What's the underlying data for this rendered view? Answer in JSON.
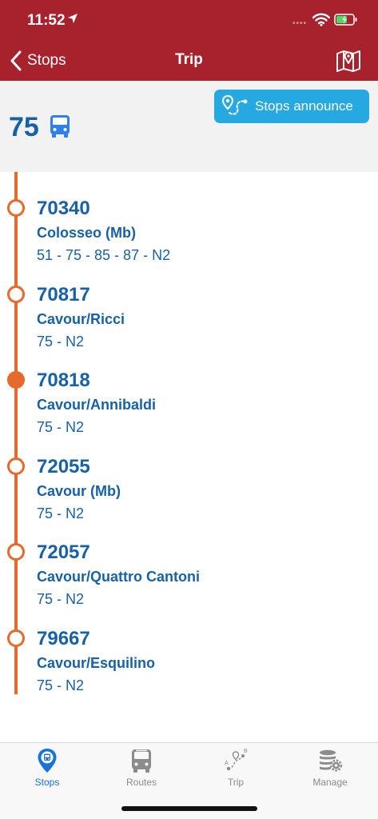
{
  "status": {
    "time": "11:52",
    "signal": "••••"
  },
  "nav": {
    "back_label": "Stops",
    "title": "Trip"
  },
  "route": {
    "number": "75",
    "announce_label": "Stops announce"
  },
  "colors": {
    "header": "#a8222e",
    "primary": "#1661a8",
    "accent": "#e56a2b",
    "button": "#25a9e0",
    "tab_active": "#1a73d9",
    "tab_inactive": "#8c8c8c"
  },
  "stops": [
    {
      "code": "70340",
      "name": "Colosseo (Mb)",
      "lines": "51 - 75 - 85 - 87 - N2",
      "current": false
    },
    {
      "code": "70817",
      "name": "Cavour/Ricci",
      "lines": "75 - N2",
      "current": false
    },
    {
      "code": "70818",
      "name": "Cavour/Annibaldi",
      "lines": "75 - N2",
      "current": true
    },
    {
      "code": "72055",
      "name": "Cavour (Mb)",
      "lines": "75 - N2",
      "current": false
    },
    {
      "code": "72057",
      "name": "Cavour/Quattro Cantoni",
      "lines": "75 - N2",
      "current": false
    },
    {
      "code": "79667",
      "name": "Cavour/Esquilino",
      "lines": "75 - N2",
      "current": false
    }
  ],
  "tabs": [
    {
      "label": "Stops",
      "icon": "bus-stop-pin-icon",
      "active": true
    },
    {
      "label": "Routes",
      "icon": "bus-icon",
      "active": false
    },
    {
      "label": "Trip",
      "icon": "route-ab-icon",
      "active": false
    },
    {
      "label": "Manage",
      "icon": "database-gear-icon",
      "active": false
    }
  ]
}
